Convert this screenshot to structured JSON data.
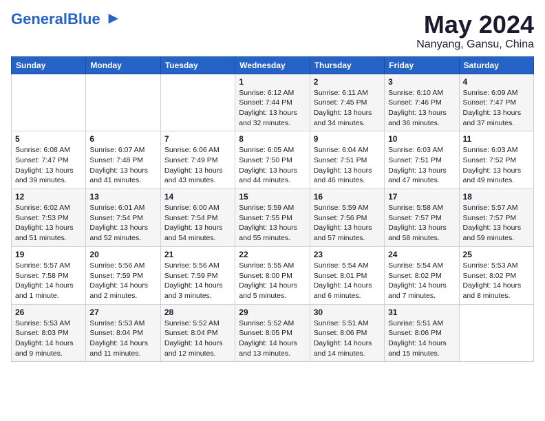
{
  "logo": {
    "general": "General",
    "blue": "Blue",
    "tagline": ""
  },
  "header": {
    "month": "May 2024",
    "location": "Nanyang, Gansu, China"
  },
  "weekdays": [
    "Sunday",
    "Monday",
    "Tuesday",
    "Wednesday",
    "Thursday",
    "Friday",
    "Saturday"
  ],
  "weeks": [
    [
      {
        "day": "",
        "info": ""
      },
      {
        "day": "",
        "info": ""
      },
      {
        "day": "",
        "info": ""
      },
      {
        "day": "1",
        "info": "Sunrise: 6:12 AM\nSunset: 7:44 PM\nDaylight: 13 hours\nand 32 minutes."
      },
      {
        "day": "2",
        "info": "Sunrise: 6:11 AM\nSunset: 7:45 PM\nDaylight: 13 hours\nand 34 minutes."
      },
      {
        "day": "3",
        "info": "Sunrise: 6:10 AM\nSunset: 7:46 PM\nDaylight: 13 hours\nand 36 minutes."
      },
      {
        "day": "4",
        "info": "Sunrise: 6:09 AM\nSunset: 7:47 PM\nDaylight: 13 hours\nand 37 minutes."
      }
    ],
    [
      {
        "day": "5",
        "info": "Sunrise: 6:08 AM\nSunset: 7:47 PM\nDaylight: 13 hours\nand 39 minutes."
      },
      {
        "day": "6",
        "info": "Sunrise: 6:07 AM\nSunset: 7:48 PM\nDaylight: 13 hours\nand 41 minutes."
      },
      {
        "day": "7",
        "info": "Sunrise: 6:06 AM\nSunset: 7:49 PM\nDaylight: 13 hours\nand 43 minutes."
      },
      {
        "day": "8",
        "info": "Sunrise: 6:05 AM\nSunset: 7:50 PM\nDaylight: 13 hours\nand 44 minutes."
      },
      {
        "day": "9",
        "info": "Sunrise: 6:04 AM\nSunset: 7:51 PM\nDaylight: 13 hours\nand 46 minutes."
      },
      {
        "day": "10",
        "info": "Sunrise: 6:03 AM\nSunset: 7:51 PM\nDaylight: 13 hours\nand 47 minutes."
      },
      {
        "day": "11",
        "info": "Sunrise: 6:03 AM\nSunset: 7:52 PM\nDaylight: 13 hours\nand 49 minutes."
      }
    ],
    [
      {
        "day": "12",
        "info": "Sunrise: 6:02 AM\nSunset: 7:53 PM\nDaylight: 13 hours\nand 51 minutes."
      },
      {
        "day": "13",
        "info": "Sunrise: 6:01 AM\nSunset: 7:54 PM\nDaylight: 13 hours\nand 52 minutes."
      },
      {
        "day": "14",
        "info": "Sunrise: 6:00 AM\nSunset: 7:54 PM\nDaylight: 13 hours\nand 54 minutes."
      },
      {
        "day": "15",
        "info": "Sunrise: 5:59 AM\nSunset: 7:55 PM\nDaylight: 13 hours\nand 55 minutes."
      },
      {
        "day": "16",
        "info": "Sunrise: 5:59 AM\nSunset: 7:56 PM\nDaylight: 13 hours\nand 57 minutes."
      },
      {
        "day": "17",
        "info": "Sunrise: 5:58 AM\nSunset: 7:57 PM\nDaylight: 13 hours\nand 58 minutes."
      },
      {
        "day": "18",
        "info": "Sunrise: 5:57 AM\nSunset: 7:57 PM\nDaylight: 13 hours\nand 59 minutes."
      }
    ],
    [
      {
        "day": "19",
        "info": "Sunrise: 5:57 AM\nSunset: 7:58 PM\nDaylight: 14 hours\nand 1 minute."
      },
      {
        "day": "20",
        "info": "Sunrise: 5:56 AM\nSunset: 7:59 PM\nDaylight: 14 hours\nand 2 minutes."
      },
      {
        "day": "21",
        "info": "Sunrise: 5:56 AM\nSunset: 7:59 PM\nDaylight: 14 hours\nand 3 minutes."
      },
      {
        "day": "22",
        "info": "Sunrise: 5:55 AM\nSunset: 8:00 PM\nDaylight: 14 hours\nand 5 minutes."
      },
      {
        "day": "23",
        "info": "Sunrise: 5:54 AM\nSunset: 8:01 PM\nDaylight: 14 hours\nand 6 minutes."
      },
      {
        "day": "24",
        "info": "Sunrise: 5:54 AM\nSunset: 8:02 PM\nDaylight: 14 hours\nand 7 minutes."
      },
      {
        "day": "25",
        "info": "Sunrise: 5:53 AM\nSunset: 8:02 PM\nDaylight: 14 hours\nand 8 minutes."
      }
    ],
    [
      {
        "day": "26",
        "info": "Sunrise: 5:53 AM\nSunset: 8:03 PM\nDaylight: 14 hours\nand 9 minutes."
      },
      {
        "day": "27",
        "info": "Sunrise: 5:53 AM\nSunset: 8:04 PM\nDaylight: 14 hours\nand 11 minutes."
      },
      {
        "day": "28",
        "info": "Sunrise: 5:52 AM\nSunset: 8:04 PM\nDaylight: 14 hours\nand 12 minutes."
      },
      {
        "day": "29",
        "info": "Sunrise: 5:52 AM\nSunset: 8:05 PM\nDaylight: 14 hours\nand 13 minutes."
      },
      {
        "day": "30",
        "info": "Sunrise: 5:51 AM\nSunset: 8:06 PM\nDaylight: 14 hours\nand 14 minutes."
      },
      {
        "day": "31",
        "info": "Sunrise: 5:51 AM\nSunset: 8:06 PM\nDaylight: 14 hours\nand 15 minutes."
      },
      {
        "day": "",
        "info": ""
      }
    ]
  ]
}
